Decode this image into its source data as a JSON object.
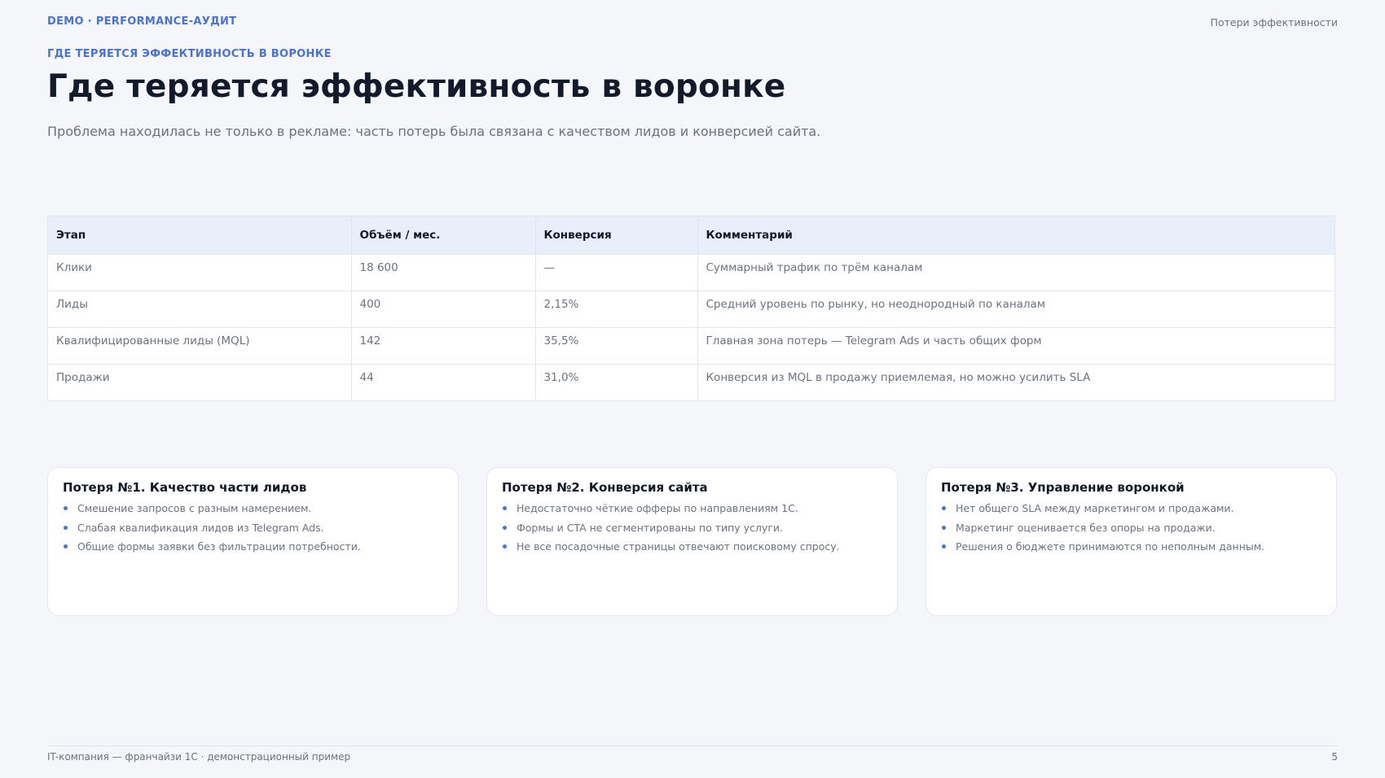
{
  "header": {
    "brand": "DEMO · PERFORMANCE-АУДИТ",
    "section": "Потери эффективности"
  },
  "slide": {
    "eyebrow": "ГДЕ ТЕРЯЕТСЯ ЭФФЕКТИВНОСТЬ В ВОРОНКЕ",
    "title": "Где теряется эффективность в воронке",
    "subtitle": "Проблема находилась не только в рекламе: часть потерь была связана с качеством лидов и конверсией сайта."
  },
  "table": {
    "headers": [
      "Этап",
      "Объём / мес.",
      "Конверсия",
      "Комментарий"
    ],
    "rows": [
      [
        "Клики",
        "18 600",
        "—",
        "Суммарный трафик по трём каналам"
      ],
      [
        "Лиды",
        "400",
        "2,15%",
        "Средний уровень по рынку, но неоднородный по каналам"
      ],
      [
        "Квалифицированные лиды (MQL)",
        "142",
        "35,5%",
        "Главная зона потерь — Telegram Ads и часть общих форм"
      ],
      [
        "Продажи",
        "44",
        "31,0%",
        "Конверсия из MQL в продажу приемлемая, но можно усилить SLA"
      ]
    ]
  },
  "cards": [
    {
      "title": "Потеря №1. Качество части лидов",
      "items": [
        "Смешение запросов с разным намерением.",
        "Слабая квалификация лидов из Telegram Ads.",
        "Общие формы заявки без фильтрации потребности."
      ]
    },
    {
      "title": "Потеря №2. Конверсия сайта",
      "items": [
        "Недостаточно чёткие офферы по направлениям 1С.",
        "Формы и CTA не сегментированы по типу услуги.",
        "Не все посадочные страницы отвечают поисковому спросу."
      ]
    },
    {
      "title": "Потеря №3. Управление воронкой",
      "items": [
        "Нет общего SLA между маркетингом и продажами.",
        "Маркетинг оценивается без опоры на продажи.",
        "Решения о бюджете принимаются по неполным данным."
      ]
    }
  ],
  "footer": {
    "caption": "IT-компания — франчайзи 1С · демонстрационный пример",
    "page_number": "5"
  },
  "colors": {
    "accent": "#4a72d4",
    "background": "#f4f6f9",
    "header_row": "#e8eefa"
  }
}
